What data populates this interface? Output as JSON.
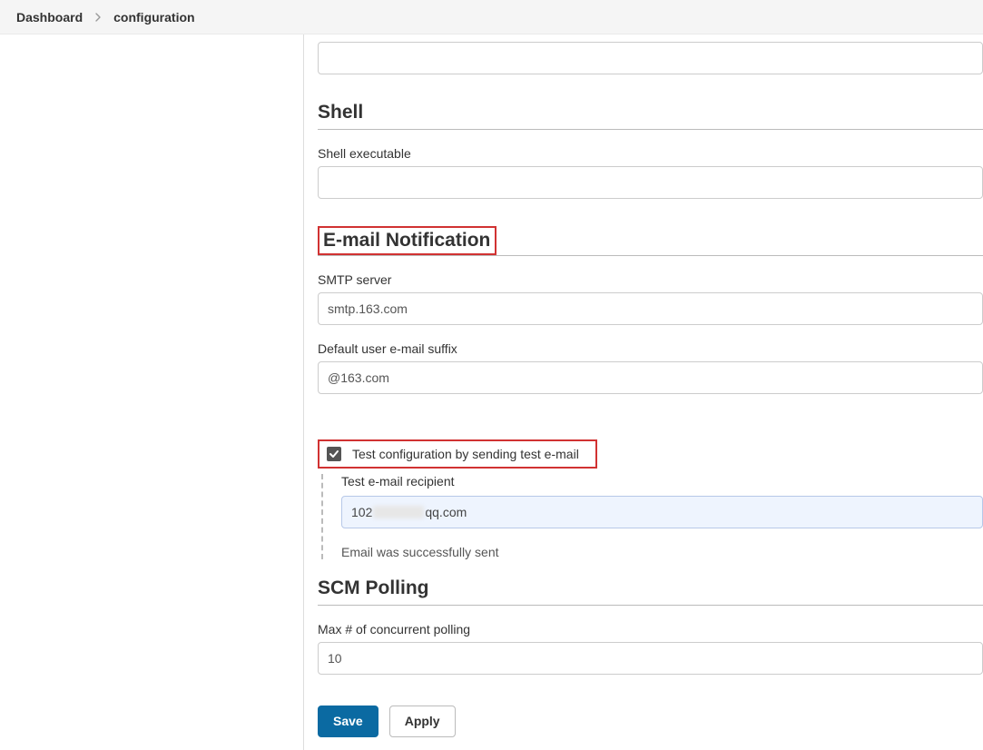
{
  "breadcrumb": {
    "items": [
      "Dashboard",
      "configuration"
    ]
  },
  "top_input": {
    "value": ""
  },
  "shell": {
    "heading": "Shell",
    "executable_label": "Shell executable",
    "executable_value": ""
  },
  "email": {
    "heading": "E-mail Notification",
    "smtp_label": "SMTP server",
    "smtp_value": "smtp.163.com",
    "suffix_label": "Default user e-mail suffix",
    "suffix_value": "@163.com",
    "test_checkbox_label": "Test configuration by sending test e-mail",
    "test_checked": true,
    "test_recipient_label": "Test e-mail recipient",
    "test_recipient_prefix": "102",
    "test_recipient_suffix": "qq.com",
    "success_msg": "Email was successfully sent"
  },
  "scm": {
    "heading": "SCM Polling",
    "max_label": "Max # of concurrent polling",
    "max_value": "10"
  },
  "buttons": {
    "save": "Save",
    "apply": "Apply"
  }
}
